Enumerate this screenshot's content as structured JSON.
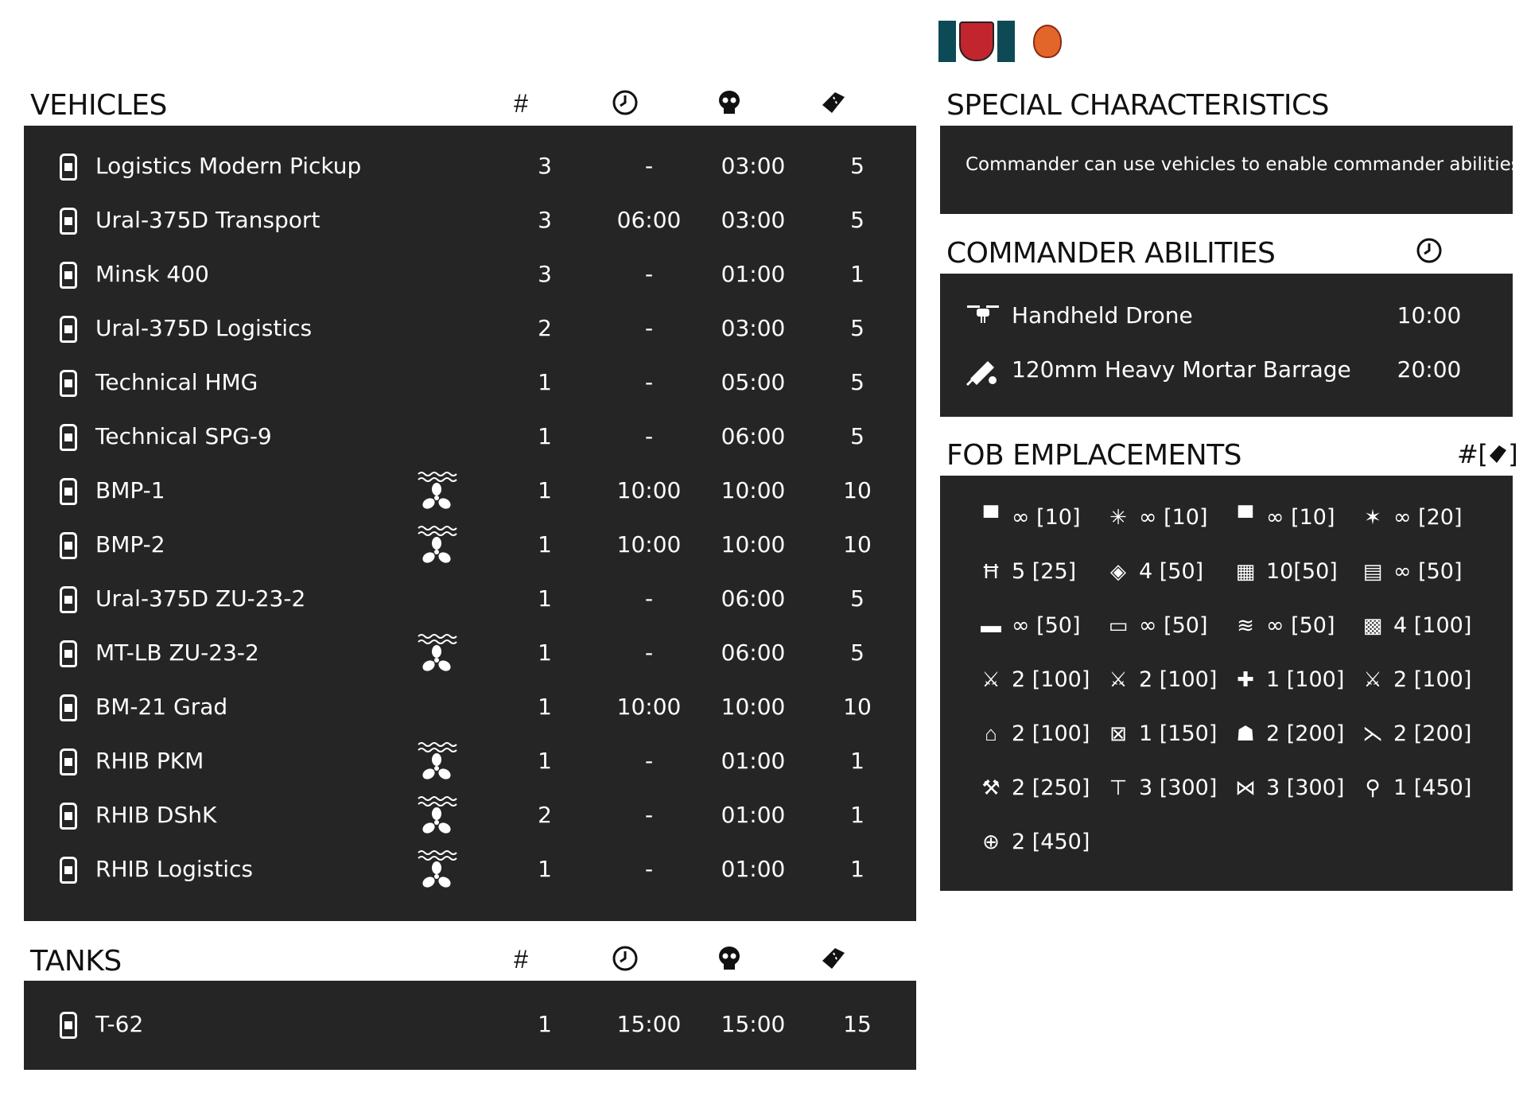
{
  "colors": {
    "panel": "#252525",
    "text_on_panel": "#ffffff",
    "heading": "#111111",
    "flag_teal": "#0d4a55"
  },
  "vehicles": {
    "title": "VEHICLES",
    "col_count": "#",
    "col_icons": [
      "clock-icon",
      "skull-icon",
      "ticket-icon"
    ],
    "rows": [
      {
        "name": "Logistics Modern Pickup",
        "amphibious": false,
        "count": "3",
        "delay": "-",
        "respawn": "03:00",
        "tickets": "5"
      },
      {
        "name": "Ural-375D Transport",
        "amphibious": false,
        "count": "3",
        "delay": "06:00",
        "respawn": "03:00",
        "tickets": "5"
      },
      {
        "name": "Minsk 400",
        "amphibious": false,
        "count": "3",
        "delay": "-",
        "respawn": "01:00",
        "tickets": "1"
      },
      {
        "name": "Ural-375D Logistics",
        "amphibious": false,
        "count": "2",
        "delay": "-",
        "respawn": "03:00",
        "tickets": "5"
      },
      {
        "name": "Technical HMG",
        "amphibious": false,
        "count": "1",
        "delay": "-",
        "respawn": "05:00",
        "tickets": "5"
      },
      {
        "name": "Technical SPG-9",
        "amphibious": false,
        "count": "1",
        "delay": "-",
        "respawn": "06:00",
        "tickets": "5"
      },
      {
        "name": "BMP-1",
        "amphibious": true,
        "count": "1",
        "delay": "10:00",
        "respawn": "10:00",
        "tickets": "10"
      },
      {
        "name": "BMP-2",
        "amphibious": true,
        "count": "1",
        "delay": "10:00",
        "respawn": "10:00",
        "tickets": "10"
      },
      {
        "name": "Ural-375D ZU-23-2",
        "amphibious": false,
        "count": "1",
        "delay": "-",
        "respawn": "06:00",
        "tickets": "5"
      },
      {
        "name": "MT-LB ZU-23-2",
        "amphibious": true,
        "count": "1",
        "delay": "-",
        "respawn": "06:00",
        "tickets": "5"
      },
      {
        "name": "BM-21 Grad",
        "amphibious": false,
        "count": "1",
        "delay": "10:00",
        "respawn": "10:00",
        "tickets": "10"
      },
      {
        "name": "RHIB PKM",
        "amphibious": true,
        "count": "1",
        "delay": "-",
        "respawn": "01:00",
        "tickets": "1"
      },
      {
        "name": "RHIB DShK",
        "amphibious": true,
        "count": "2",
        "delay": "-",
        "respawn": "01:00",
        "tickets": "1"
      },
      {
        "name": "RHIB Logistics",
        "amphibious": true,
        "count": "1",
        "delay": "-",
        "respawn": "01:00",
        "tickets": "1"
      }
    ]
  },
  "tanks": {
    "title": "TANKS",
    "col_count": "#",
    "rows": [
      {
        "name": "T-62",
        "amphibious": false,
        "count": "1",
        "delay": "15:00",
        "respawn": "15:00",
        "tickets": "15"
      }
    ]
  },
  "special": {
    "title": "SPECIAL CHARACTERISTICS",
    "text": "Commander can use vehicles to enable commander abilities"
  },
  "commander": {
    "title": "COMMANDER ABILITIES",
    "rows": [
      {
        "name": "Handheld Drone",
        "time": "10:00",
        "icon": "drone-icon"
      },
      {
        "name": "120mm Heavy Mortar Barrage",
        "time": "20:00",
        "icon": "artillery-strike-icon"
      }
    ]
  },
  "fob": {
    "title": "FOB EMPLACEMENTS",
    "header_right": "#[",
    "header_close": "]",
    "items": [
      {
        "icon": "sandbag-icon",
        "value": "∞ [10]"
      },
      {
        "icon": "razorwire-icon",
        "value": "∞ [10]"
      },
      {
        "icon": "sandbag-wall-icon",
        "value": "∞ [10]"
      },
      {
        "icon": "tank-trap-icon",
        "value": "∞ [20]"
      },
      {
        "icon": "hesco-icon",
        "value": "5 [25]"
      },
      {
        "icon": "ammo-crate-icon",
        "value": "4 [50]"
      },
      {
        "icon": "camo-net-icon",
        "value": "10[50]"
      },
      {
        "icon": "bunker-icon",
        "value": "∞ [50]"
      },
      {
        "icon": "barrier-icon",
        "value": "∞ [50]"
      },
      {
        "icon": "block-wall-icon",
        "value": "∞ [50]"
      },
      {
        "icon": "sandbag-pile-icon",
        "value": "∞ [50]"
      },
      {
        "icon": "netting-icon",
        "value": "4 [100]"
      },
      {
        "icon": "hmg-emplacement-icon",
        "value": "2 [100]"
      },
      {
        "icon": "mg-emplacement-icon",
        "value": "2 [100]"
      },
      {
        "icon": "medical-station-icon",
        "value": "1 [100]"
      },
      {
        "icon": "tripod-gun-icon",
        "value": "2 [100]"
      },
      {
        "icon": "watchtower-icon",
        "value": "2 [100]"
      },
      {
        "icon": "ammo-cache-icon",
        "value": "1 [150]"
      },
      {
        "icon": "rocket-pod-icon",
        "value": "2 [200]"
      },
      {
        "icon": "mortar-icon",
        "value": "2 [200]"
      },
      {
        "icon": "aa-gun-icon",
        "value": "2 [250]"
      },
      {
        "icon": "spg-icon",
        "value": "3 [300]"
      },
      {
        "icon": "atgm-icon",
        "value": "3 [300]"
      },
      {
        "icon": "searchlight-icon",
        "value": "1 [450]"
      },
      {
        "icon": "field-gun-icon",
        "value": "2 [450]"
      }
    ]
  }
}
